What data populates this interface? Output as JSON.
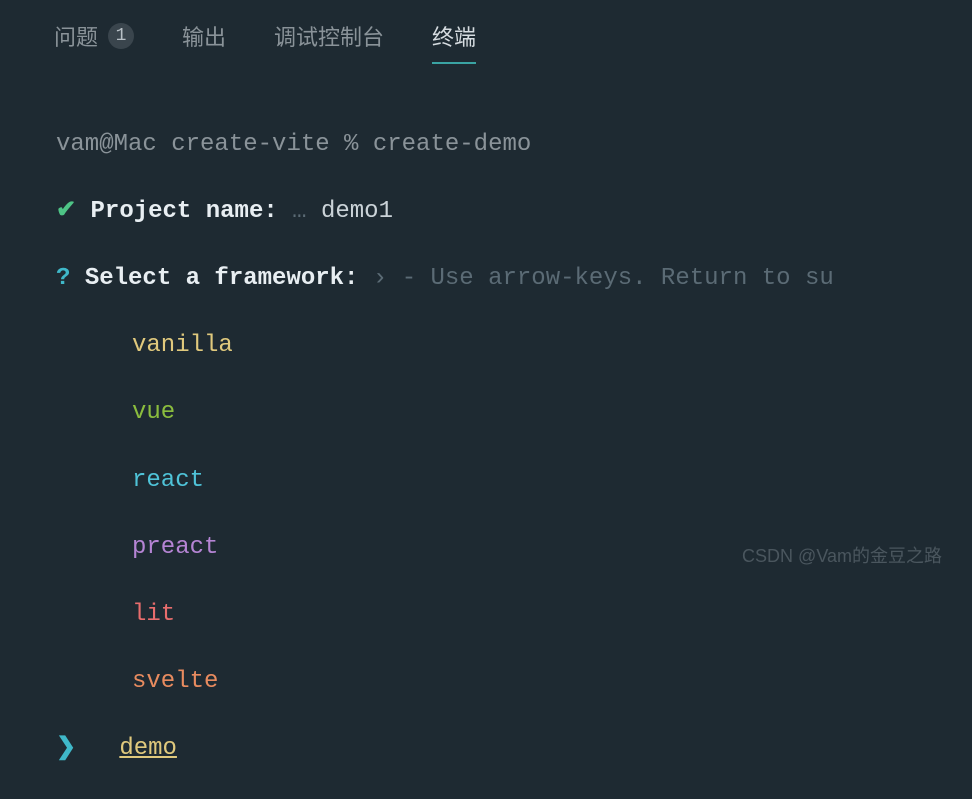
{
  "tabs": {
    "problems": {
      "label": "问题",
      "badge": "1"
    },
    "output": {
      "label": "输出"
    },
    "debug": {
      "label": "调试控制台"
    },
    "terminal": {
      "label": "终端"
    }
  },
  "terminal": {
    "prompt": "vam@Mac create-vite % create-demo",
    "check_symbol": "✔",
    "project_label": "Project name:",
    "ellipsis": "…",
    "project_value": "demo1",
    "question_symbol": "?",
    "select_label": "Select a framework:",
    "arrow_symbol": "›",
    "hint": "- Use arrow-keys. Return to su",
    "options": {
      "vanilla": "vanilla",
      "vue": "vue",
      "react": "react",
      "preact": "preact",
      "lit": "lit",
      "svelte": "svelte",
      "demo": "demo"
    },
    "selection_cursor": "❯"
  },
  "watermark": "CSDN @Vam的金豆之路"
}
